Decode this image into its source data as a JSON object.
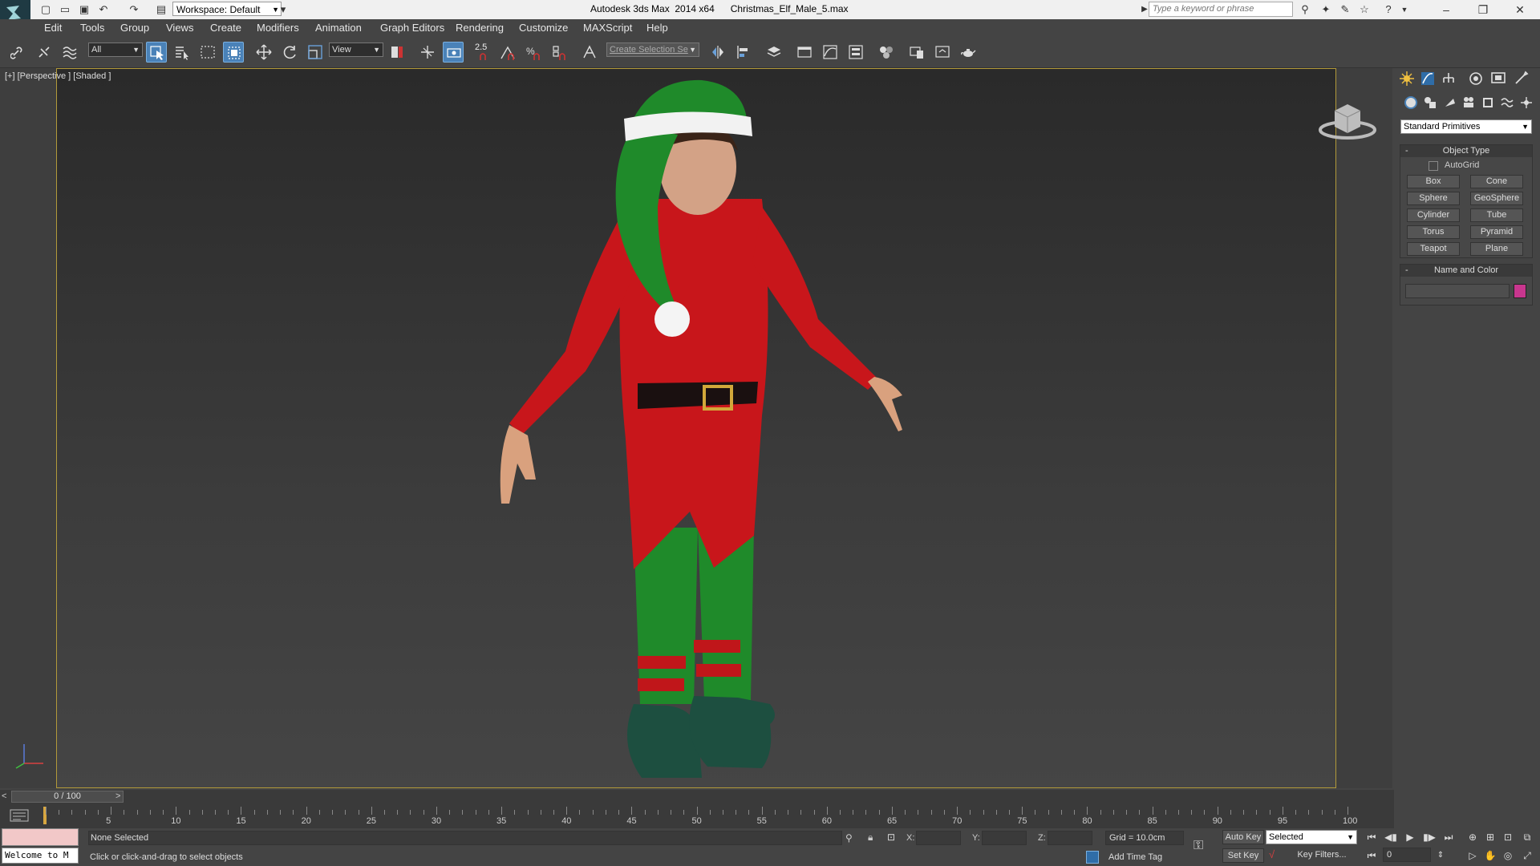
{
  "titlebar": {
    "workspace": "Workspace: Default",
    "title": "Autodesk 3ds Max  2014 x64      Christmas_Elf_Male_5.max",
    "search_placeholder": "Type a keyword or phrase"
  },
  "menu": [
    "Edit",
    "Tools",
    "Group",
    "Views",
    "Create",
    "Modifiers",
    "Animation",
    "Graph Editors",
    "Rendering",
    "Customize",
    "MAXScript",
    "Help"
  ],
  "toolbar": {
    "selection_filter": "All",
    "ref_coord": "View",
    "snap_label": "2.5",
    "named_selection": "Create Selection Se"
  },
  "viewport": {
    "label": "[+] [Perspective ] [Shaded ]"
  },
  "command_panel": {
    "category": "Standard Primitives",
    "object_type_title": "Object Type",
    "autogrid": "AutoGrid",
    "buttons": [
      "Box",
      "Cone",
      "Sphere",
      "GeoSphere",
      "Cylinder",
      "Tube",
      "Torus",
      "Pyramid",
      "Teapot",
      "Plane"
    ],
    "name_color_title": "Name and Color",
    "object_color": "#c8368e"
  },
  "timeline": {
    "frame_display": "0 / 100",
    "ticks": [
      "5",
      "10",
      "15",
      "20",
      "25",
      "30",
      "35",
      "40",
      "45",
      "50",
      "55",
      "60",
      "65",
      "70",
      "75",
      "80",
      "85",
      "90",
      "95",
      "100"
    ]
  },
  "status": {
    "listener": "Welcome to M",
    "selection": "None Selected",
    "prompt": "Click or click-and-drag to select objects",
    "x_label": "X:",
    "y_label": "Y:",
    "z_label": "Z:",
    "grid": "Grid = 10.0cm",
    "add_time_tag": "Add Time Tag",
    "auto_key": "Auto Key",
    "set_key": "Set Key",
    "key_mode": "Selected",
    "key_filters": "Key Filters...",
    "current_frame": "0"
  }
}
